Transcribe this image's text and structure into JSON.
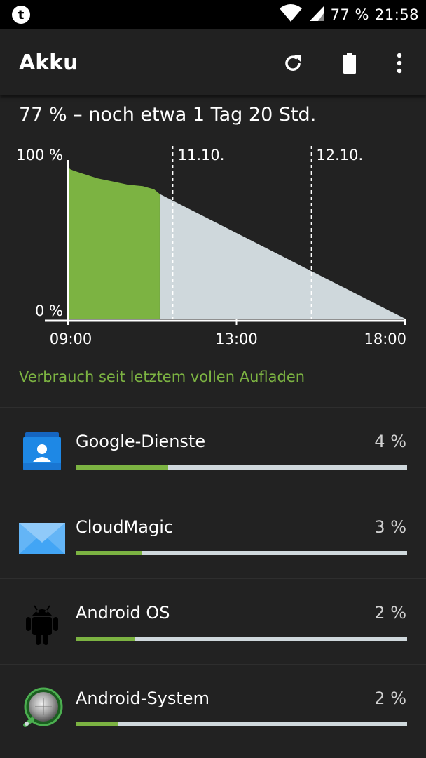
{
  "status_bar": {
    "notification_icon": "t-app-icon",
    "battery_percent": "77 %",
    "time": "21:58"
  },
  "app_bar": {
    "title": "Akku",
    "actions": [
      "refresh-icon",
      "battery-icon",
      "more-vert-icon"
    ]
  },
  "summary": "77 % – noch etwa 1 Tag 20 Std.",
  "chart_data": {
    "type": "area",
    "series": [
      {
        "x": [
          0,
          0.05,
          0.15,
          0.4,
          0.8,
          1.2,
          1.6,
          2.0,
          2.3,
          2.45
        ],
        "values": [
          100,
          96,
          95,
          93,
          90,
          88,
          86,
          85,
          83,
          80
        ]
      },
      {
        "x": [
          2.45,
          9.0
        ],
        "values": [
          80,
          0
        ]
      }
    ],
    "ylim": [
      0,
      100
    ],
    "xlim": [
      0,
      9.0
    ],
    "y_ticks": [
      "100 %",
      "0 %"
    ],
    "x_ticks": [
      {
        "x": 0,
        "label": "09:00"
      },
      {
        "x": 4.5,
        "label": "13:00"
      },
      {
        "x": 9.0,
        "label": "18:00"
      }
    ],
    "day_markers": [
      {
        "x": 2.8,
        "label": "11.10."
      },
      {
        "x": 6.5,
        "label": "12.10."
      }
    ],
    "colors": {
      "measured": "#7cb342",
      "prediction": "#cfd8dc",
      "axis": "#ffffff"
    }
  },
  "section_title": "Verbrauch seit letztem vollen Aufladen",
  "apps": [
    {
      "name": "Google-Dienste",
      "percent": "4 %",
      "bar_fraction": 0.28,
      "icon": "contacts-icon"
    },
    {
      "name": "CloudMagic",
      "percent": "3 %",
      "bar_fraction": 0.2,
      "icon": "mail-envelope-icon"
    },
    {
      "name": "Android OS",
      "percent": "2 %",
      "bar_fraction": 0.18,
      "icon": "android-robot-icon"
    },
    {
      "name": "Android-System",
      "percent": "2 %",
      "bar_fraction": 0.13,
      "icon": "android-system-gear-icon"
    }
  ]
}
